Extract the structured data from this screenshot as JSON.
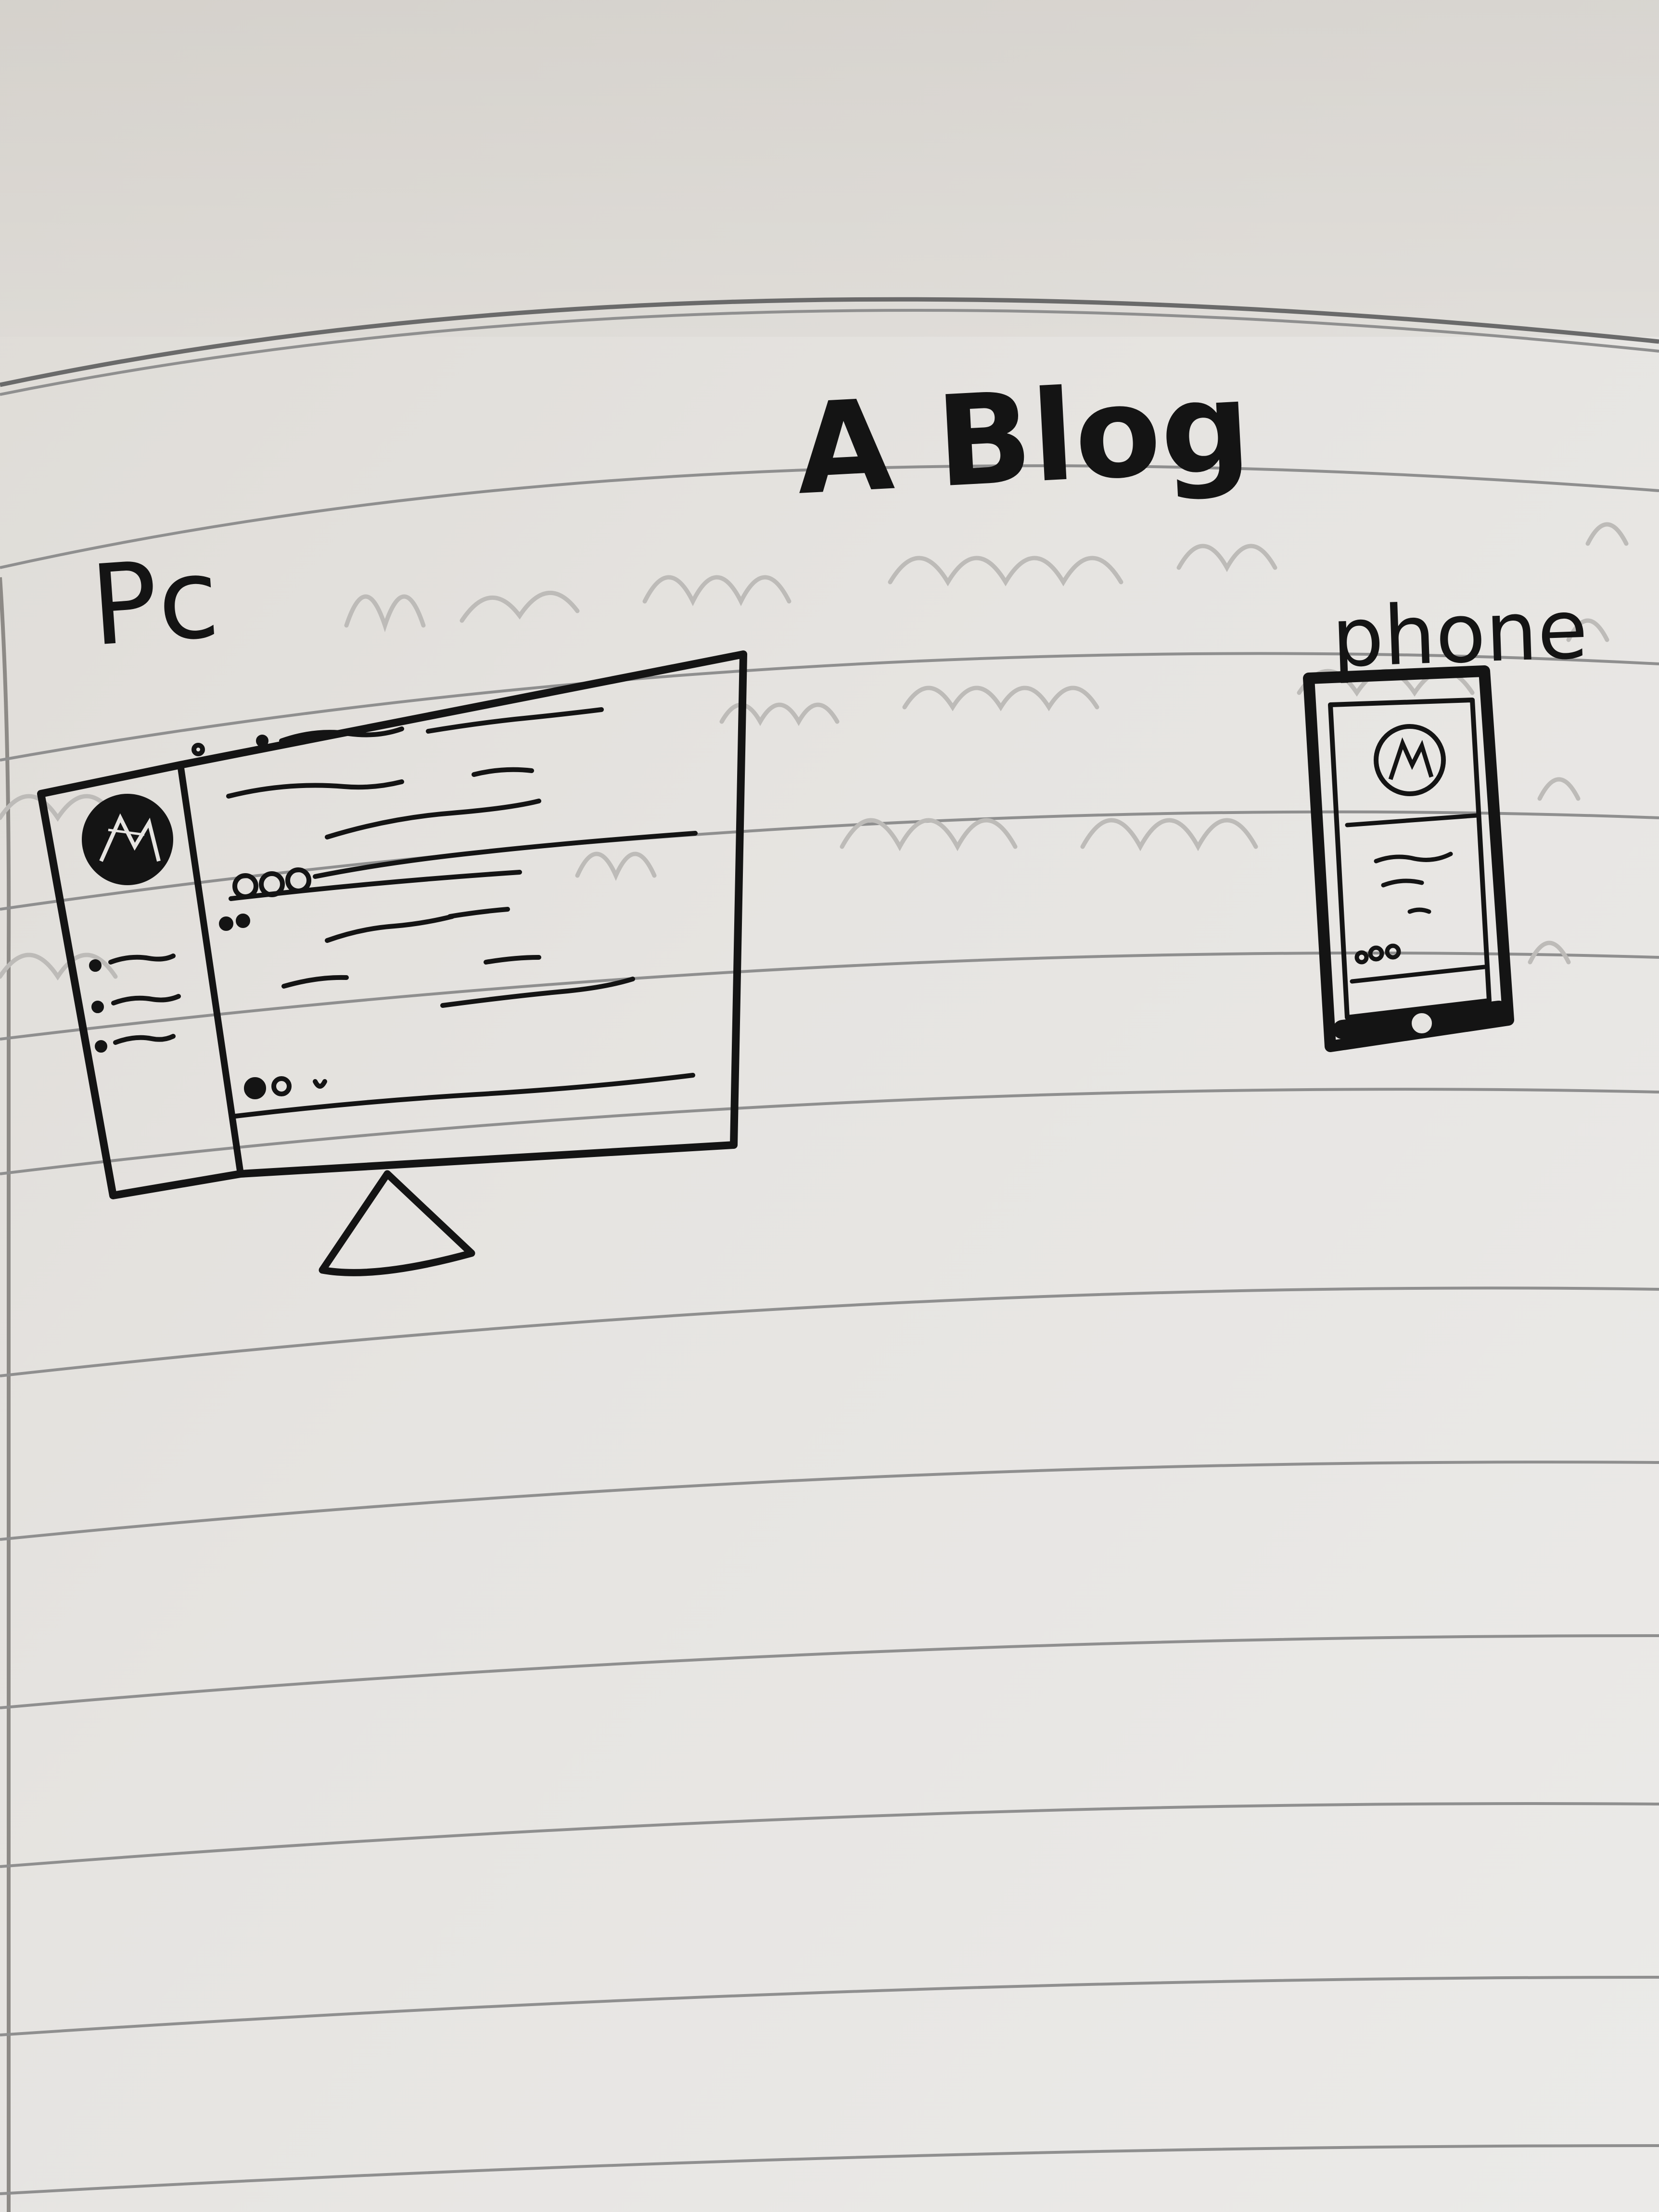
{
  "photo": {
    "title": "A Blog",
    "label_pc": "Pc",
    "label_phone": "phone"
  },
  "colors": {
    "paper": "#e8e6e3",
    "ink": "#141414",
    "rule_line": "#9a9a9a",
    "bleed_through": "#bdbbb8"
  },
  "icons": {
    "pc_avatar": "avatar-icon",
    "phone_avatar": "avatar-icon",
    "phone_home": "home-button-icon"
  }
}
